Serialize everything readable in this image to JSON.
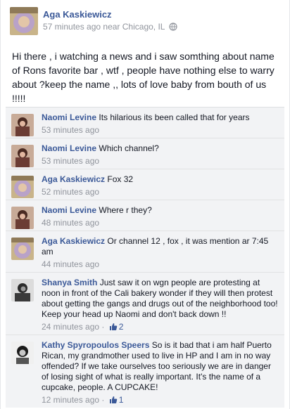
{
  "post": {
    "author": "Aga Kaskiewicz",
    "time": "57 minutes ago",
    "location": "near Chicago, IL",
    "privacy_icon": "globe-icon",
    "text": "Hi there , i watching a news and i saw somthing about name of Rons favorite bar , wtf , people have nothing else to warry about ?keep the name ,, lots of love baby from bouth of us !!!!!"
  },
  "comments": [
    {
      "author": "Naomi Levine",
      "text": "Its hilarious its been called that for years",
      "time": "53 minutes ago",
      "likes": ""
    },
    {
      "author": "Naomi Levine",
      "text": "Which channel?",
      "time": "53 minutes ago",
      "likes": ""
    },
    {
      "author": "Aga Kaskiewicz",
      "text": "Fox 32",
      "time": "52 minutes ago",
      "likes": ""
    },
    {
      "author": "Naomi Levine",
      "text": "Where r they?",
      "time": "48 minutes ago",
      "likes": ""
    },
    {
      "author": "Aga Kaskiewicz",
      "text": "Or channel 12 , fox , it was mention ar 7:45 am",
      "time": "44 minutes ago",
      "likes": ""
    },
    {
      "author": "Shanya Smith",
      "text": "Just saw it on wgn people are protesting at noon in front of the Cali bakery wonder if they will then protest about getting the gangs and drugs out of the neighborhood too! Keep your head up Naomi and don't back down !!",
      "time": "24 minutes ago",
      "likes": "2"
    },
    {
      "author": "Kathy Spyropoulos Speers",
      "text": "So is it bad that i am half Puerto Rican, my grandmother used to live in HP and I am in no way offended? If we take ourselves too seriously we are in danger of losing sight of what is really important. It's the name of a cupcake, people. A CUPCAKE!",
      "time": "12 minutes ago",
      "likes": "1"
    }
  ],
  "theme": {
    "link": "#3b5998",
    "meta": "#90949c",
    "comment_bg": "#f2f3f5"
  }
}
